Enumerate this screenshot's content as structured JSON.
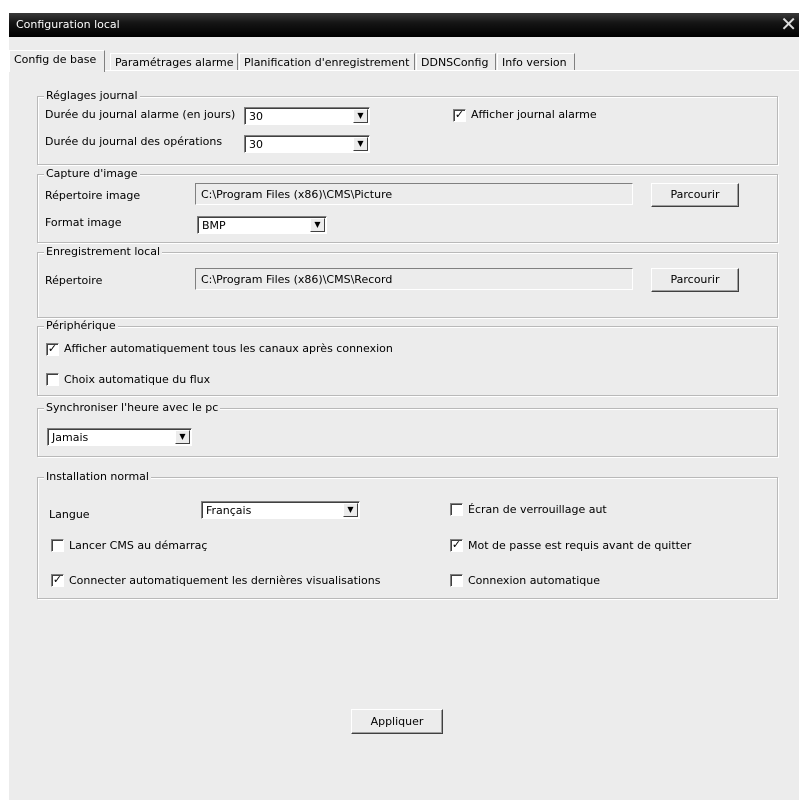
{
  "window": {
    "title": "Configuration local",
    "close_glyph": "✕"
  },
  "tabs": [
    {
      "label": "Config de base",
      "active": true
    },
    {
      "label": "Paramétrages alarme"
    },
    {
      "label": "Planification d'enregistrement"
    },
    {
      "label": "DDNSConfig"
    },
    {
      "label": "Info version"
    }
  ],
  "journal": {
    "legend": "Réglages journal",
    "alarm_duration_label": "Durée du journal alarme (en jours)",
    "alarm_duration_value": "30",
    "ops_duration_label": "Durée du journal des opérations",
    "ops_duration_value": "30",
    "show_alarm_log_label": "Afficher journal alarme",
    "show_alarm_log_checked": true
  },
  "capture": {
    "legend": "Capture d'image",
    "dir_label": "Répertoire image",
    "dir_value": "C:\\Program Files (x86)\\CMS\\Picture",
    "browse_label": "Parcourir",
    "format_label": "Format image",
    "format_value": "BMP"
  },
  "record": {
    "legend": "Enregistrement local",
    "dir_label": "Répertoire",
    "dir_value": "C:\\Program Files (x86)\\CMS\\Record",
    "browse_label": "Parcourir"
  },
  "device": {
    "legend": "Périphérique",
    "auto_show_label": "Afficher automatiquement tous les canaux après connexion",
    "auto_show_checked": true,
    "auto_stream_label": "Choix automatique du flux",
    "auto_stream_checked": false
  },
  "sync": {
    "legend": "Synchroniser l'heure avec le pc",
    "value": "Jamais"
  },
  "install": {
    "legend": "Installation normal",
    "lang_label": "Langue",
    "lang_value": "Français",
    "lock_label": "Écran de verrouillage aut",
    "lock_checked": false,
    "launch_label": "Lancer CMS au démarraç",
    "launch_checked": false,
    "password_label": "Mot de passe est requis avant de quitter",
    "password_checked": true,
    "reconnect_label": "Connecter automatiquement les dernières visualisations",
    "reconnect_checked": true,
    "autologin_label": "Connexion automatique",
    "autologin_checked": false
  },
  "apply_label": "Appliquer",
  "icons": {
    "dropdown": "chevron-down-icon",
    "check": "check-icon",
    "close": "close-icon"
  },
  "colors": {
    "window_bg": "#ececec",
    "titlebar": "#000000"
  }
}
